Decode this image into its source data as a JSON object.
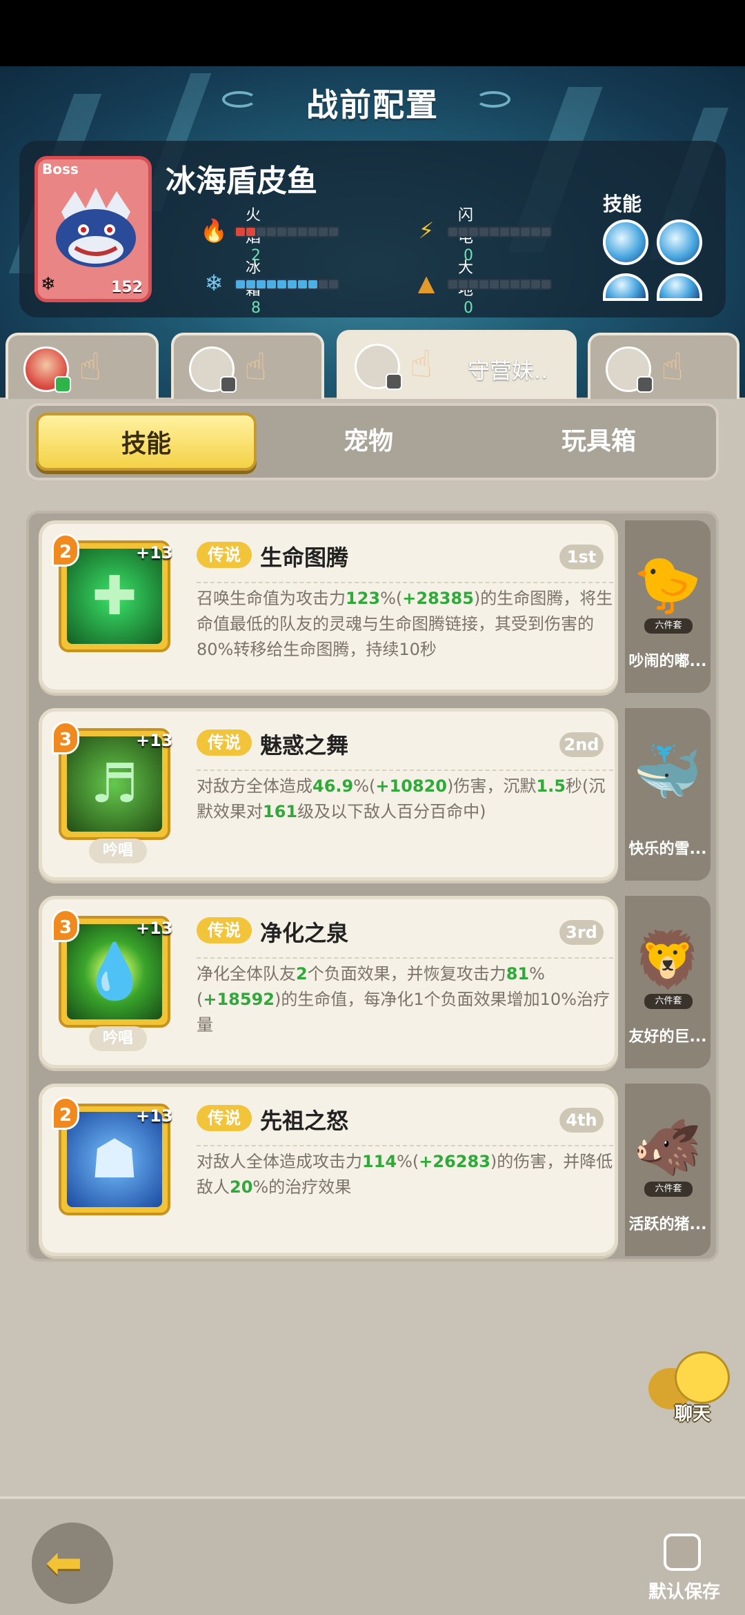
{
  "page": {
    "title": "战前配置"
  },
  "boss": {
    "tag": "Boss",
    "name": "冰海盾皮鱼",
    "level": "152",
    "skills_label": "技能",
    "stats": [
      {
        "label": "火焰",
        "value": "2",
        "icon": "flame-icon",
        "filled": 2,
        "color": "#e1463a"
      },
      {
        "label": "闪电",
        "value": "0",
        "icon": "lightning-icon",
        "filled": 0,
        "color": "#f3c336"
      },
      {
        "label": "冰霜",
        "value": "8",
        "icon": "snowflake-icon",
        "filled": 8,
        "color": "#4ab0e6"
      },
      {
        "label": "大地",
        "value": "0",
        "icon": "mountain-icon",
        "filled": 0,
        "color": "#e39a2b"
      }
    ]
  },
  "hero_tabs": [
    {
      "name": "",
      "active": false
    },
    {
      "name": "",
      "active": false
    },
    {
      "name": "守营妹..",
      "active": true
    },
    {
      "name": "",
      "active": false
    }
  ],
  "categories": [
    {
      "label": "技能",
      "active": true
    },
    {
      "label": "宠物",
      "active": false
    },
    {
      "label": "玩具箱",
      "active": false
    }
  ],
  "skills": [
    {
      "level": "2",
      "plus": "+13",
      "rarity": "传说",
      "name": "生命图腾",
      "rank": "1st",
      "tag": "",
      "desc_parts": [
        [
          "召唤生命值为攻击力",
          false
        ],
        [
          "123",
          true
        ],
        [
          "%(",
          false
        ],
        [
          "+28385",
          true
        ],
        [
          ")的生命图腾，将生命值最低的队友的灵魂与生命图腾链接，其受到伤害的80%转移给生命图腾，持续10秒",
          false
        ]
      ],
      "pet": {
        "set": "六件套",
        "name": "吵闹的嘟..."
      }
    },
    {
      "level": "3",
      "plus": "+13",
      "rarity": "传说",
      "name": "魅惑之舞",
      "rank": "2nd",
      "tag": "吟唱",
      "desc_parts": [
        [
          "对敌方全体造成",
          false
        ],
        [
          "46.9",
          true
        ],
        [
          "%(",
          false
        ],
        [
          "+10820",
          true
        ],
        [
          ")伤害，沉默",
          false
        ],
        [
          "1.5",
          true
        ],
        [
          "秒(沉默效果对",
          false
        ],
        [
          "161",
          true
        ],
        [
          "级及以下敌人百分百命中)",
          false
        ]
      ],
      "pet": {
        "set": "",
        "name": "快乐的雪..."
      }
    },
    {
      "level": "3",
      "plus": "+13",
      "rarity": "传说",
      "name": "净化之泉",
      "rank": "3rd",
      "tag": "吟唱",
      "desc_parts": [
        [
          "净化全体队友",
          false
        ],
        [
          "2",
          true
        ],
        [
          "个负面效果，并恢复攻击力",
          false
        ],
        [
          "81",
          true
        ],
        [
          "%(",
          false
        ],
        [
          "+18592",
          true
        ],
        [
          ")的生命值，每净化1个负面效果增加10%治疗量",
          false
        ]
      ],
      "pet": {
        "set": "六件套",
        "name": "友好的巨..."
      }
    },
    {
      "level": "2",
      "plus": "+13",
      "rarity": "传说",
      "name": "先祖之怒",
      "rank": "4th",
      "tag": "",
      "desc_parts": [
        [
          "对敌人全体造成攻击力",
          false
        ],
        [
          "114",
          true
        ],
        [
          "%(",
          false
        ],
        [
          "+26283",
          true
        ],
        [
          ")的伤害，并降低敌人",
          false
        ],
        [
          "20",
          true
        ],
        [
          "%的治疗效果",
          false
        ]
      ],
      "pet": {
        "set": "六件套",
        "name": "活跃的猪..."
      }
    }
  ],
  "chat": {
    "label": "聊天"
  },
  "bottom": {
    "save_label": "默认保存"
  }
}
